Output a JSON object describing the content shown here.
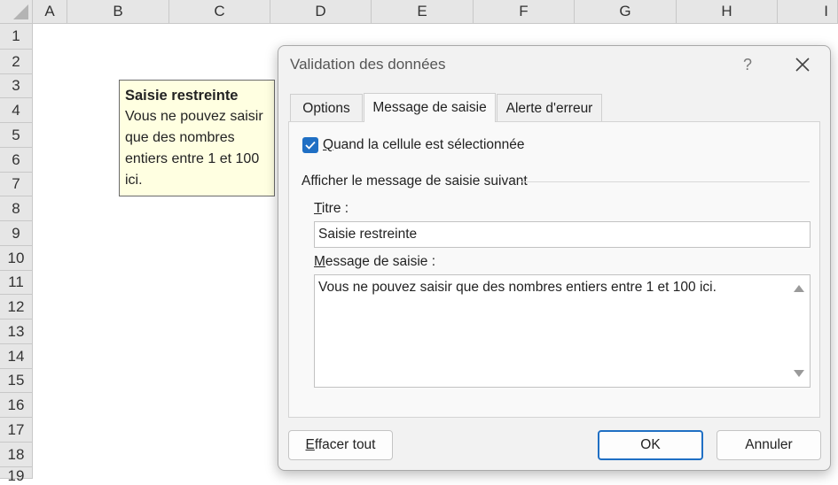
{
  "sheet": {
    "columns": [
      "A",
      "B",
      "C",
      "D",
      "E",
      "F",
      "G",
      "H",
      "I"
    ],
    "rows": [
      "1",
      "2",
      "3",
      "4",
      "5",
      "6",
      "7",
      "8",
      "9",
      "10",
      "11",
      "12",
      "13",
      "14",
      "15",
      "16",
      "17",
      "18",
      "19"
    ]
  },
  "tooltip": {
    "title": "Saisie restreinte",
    "lines": [
      "Vous ne pouvez saisir",
      "que des nombres",
      "entiers entre 1 et 100",
      "ici."
    ]
  },
  "dialog": {
    "title": "Validation des données",
    "help": "?",
    "tabs": [
      {
        "label": "Options"
      },
      {
        "label": "Message de saisie",
        "active": true
      },
      {
        "label": "Alerte d'erreur"
      }
    ],
    "checkbox": {
      "checked": true,
      "label_accel": "Q",
      "label_rest": "uand la cellule est sélectionnée"
    },
    "group_label": "Afficher le message de saisie suivant",
    "title_field": {
      "label_accel": "T",
      "label_rest": "itre :",
      "value": "Saisie restreinte"
    },
    "message_field": {
      "label_accel": "M",
      "label_rest": "essage de saisie :",
      "value": "Vous ne pouvez saisir que des nombres entiers entre 1 et 100 ici."
    },
    "buttons": {
      "clear_accel": "E",
      "clear_rest": "ffacer tout",
      "ok": "OK",
      "cancel": "Annuler"
    }
  },
  "colors": {
    "accent": "#1f6fc4",
    "tooltip_bg": "#ffffe1",
    "header_bg": "#e6e6e6"
  }
}
